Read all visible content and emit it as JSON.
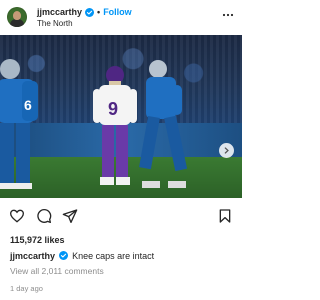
{
  "post": {
    "username": "jjmccarthy",
    "follow_label": "Follow",
    "separator": "•",
    "location": "The North",
    "likes": "115,972 likes",
    "caption_user": "jjmccarthy",
    "caption_text": "Knee caps are intact",
    "view_comments": "View all 2,011 comments",
    "time_ago": "1 day ago"
  },
  "photo": {
    "jersey_number": "9",
    "right_player_number": "6"
  },
  "icons": {
    "avatar": "profile-avatar",
    "verified": "verified-badge-icon",
    "more": "more-options-icon",
    "next": "chevron-right-icon",
    "like": "heart-icon",
    "comment": "comment-icon",
    "share": "send-icon",
    "save": "bookmark-icon"
  },
  "colors": {
    "accent": "#0095f6",
    "text": "#262626",
    "muted": "#8e8e8e"
  }
}
